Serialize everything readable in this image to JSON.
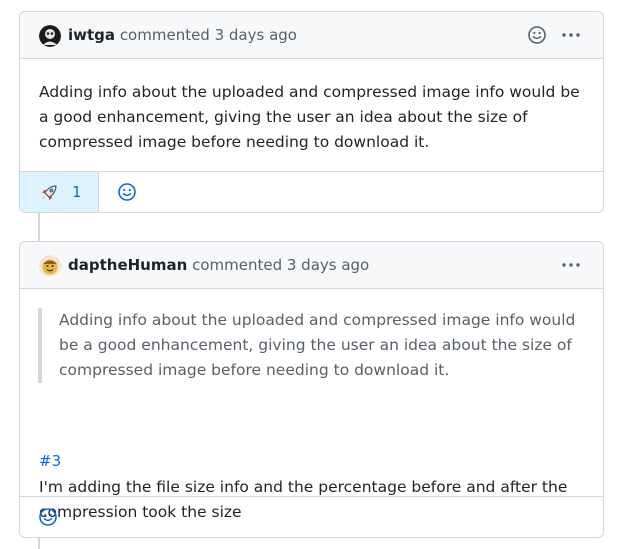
{
  "comments": [
    {
      "author": "iwtga",
      "meta": "commented 3 days ago",
      "body": "Adding info about the uploaded and compressed image info would be a good enhancement, giving the user an idea about the size of compressed image before needing to download it.",
      "reactions": [
        {
          "icon": "rocket-icon",
          "count": "1"
        }
      ]
    },
    {
      "author": "daptheHuman",
      "meta": "commented 3 days ago",
      "quote": "Adding info about the uploaded and compressed image info would be a good enhancement, giving the user an idea about the size of compressed image before needing to download it.",
      "issue_ref": "#3",
      "body": "I'm adding the file size info and the percentage before and after the compression took the size"
    }
  ],
  "colors": {
    "accent": "#0969da",
    "border": "#d0d7de",
    "header_bg": "#f6f8fa",
    "reaction_bg": "#ddf4ff",
    "muted": "#57606a"
  }
}
